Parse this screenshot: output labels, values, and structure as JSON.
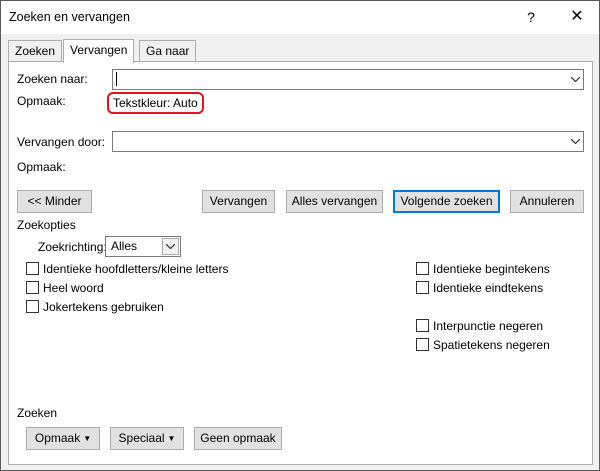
{
  "window": {
    "title": "Zoeken en vervangen",
    "help_glyph": "?",
    "close_glyph": "✕"
  },
  "tabs": [
    {
      "label": "Zoeken",
      "active": false
    },
    {
      "label": "Vervangen",
      "active": true
    },
    {
      "label": "Ga naar",
      "active": false
    }
  ],
  "find": {
    "label": "Zoeken naar:",
    "value": "",
    "format_label": "Opmaak:",
    "format_value": "Tekstkleur: Auto"
  },
  "replace": {
    "label": "Vervangen door:",
    "value": "",
    "format_label": "Opmaak:",
    "format_value": ""
  },
  "buttons": {
    "less": "<< Minder",
    "replace": "Vervangen",
    "replace_all": "Alles vervangen",
    "find_next": "Volgende zoeken",
    "cancel": "Annuleren"
  },
  "search_options": {
    "title": "Zoekopties",
    "direction_label": "Zoekrichting:",
    "direction_value": "Alles",
    "left_checks": [
      {
        "label": "Identieke hoofdletters/kleine letters",
        "checked": false
      },
      {
        "label": "Heel woord",
        "checked": false
      },
      {
        "label": "Jokertekens gebruiken",
        "checked": false
      }
    ],
    "right_checks": [
      {
        "label": "Identieke begintekens",
        "checked": false
      },
      {
        "label": "Identieke eindtekens",
        "checked": false
      },
      {
        "label": "Interpunctie negeren",
        "checked": false
      },
      {
        "label": "Spatietekens negeren",
        "checked": false
      }
    ]
  },
  "bottom": {
    "title": "Zoeken",
    "format_button": "Opmaak",
    "special_button": "Speciaal",
    "no_format_button": "Geen opmaak",
    "dropdown_glyph": "▼"
  },
  "colors": {
    "highlight_border": "#e0141e",
    "default_button_border": "#0078d7"
  }
}
